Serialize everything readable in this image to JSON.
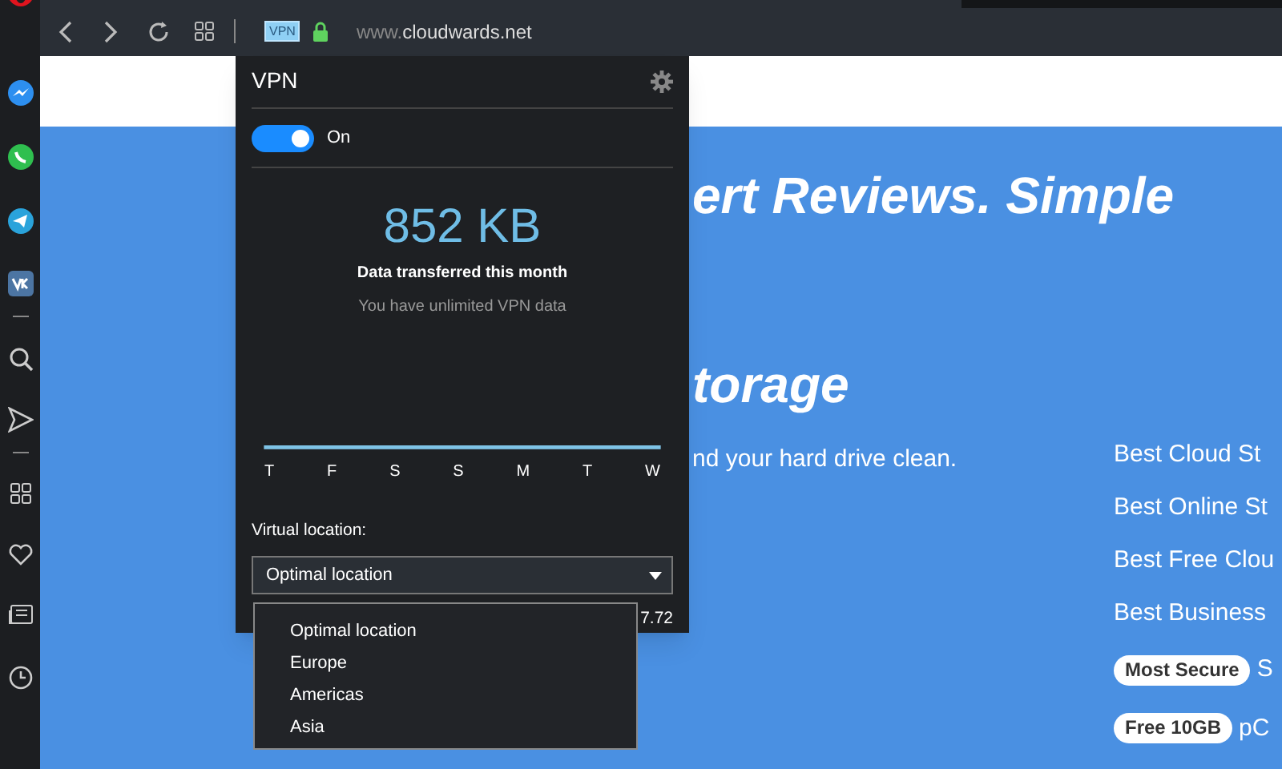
{
  "address_bar": {
    "vpn_badge": "VPN",
    "url_prefix": "www.",
    "url_domain": "cloudwards.net"
  },
  "page": {
    "headline": "ert Reviews. Simple",
    "heading": "torage",
    "tagline": "nd your hard drive clean.",
    "links": [
      "Best Cloud St",
      "Best Online St",
      "Best Free Clou",
      "Best Business"
    ],
    "badge_rows": [
      {
        "badge": "Most Secure",
        "text": "S"
      },
      {
        "badge": "Free 10GB",
        "text": "pC"
      }
    ]
  },
  "vpn_popup": {
    "title": "VPN",
    "toggle": {
      "on": true,
      "label": "On"
    },
    "usage": "852 KB",
    "usage_caption": "Data transferred this month",
    "note": "You have unlimited VPN data",
    "days": [
      "T",
      "F",
      "S",
      "S",
      "M",
      "T",
      "W"
    ],
    "location_label": "Virtual location:",
    "select": {
      "value": "Optimal location",
      "expanded": true
    },
    "options": [
      {
        "label": "Optimal location",
        "selected": false
      },
      {
        "label": "Europe",
        "selected": false
      },
      {
        "label": "Americas",
        "selected": false
      },
      {
        "label": "Asia",
        "selected": false
      }
    ],
    "partial_text": "7.72"
  }
}
